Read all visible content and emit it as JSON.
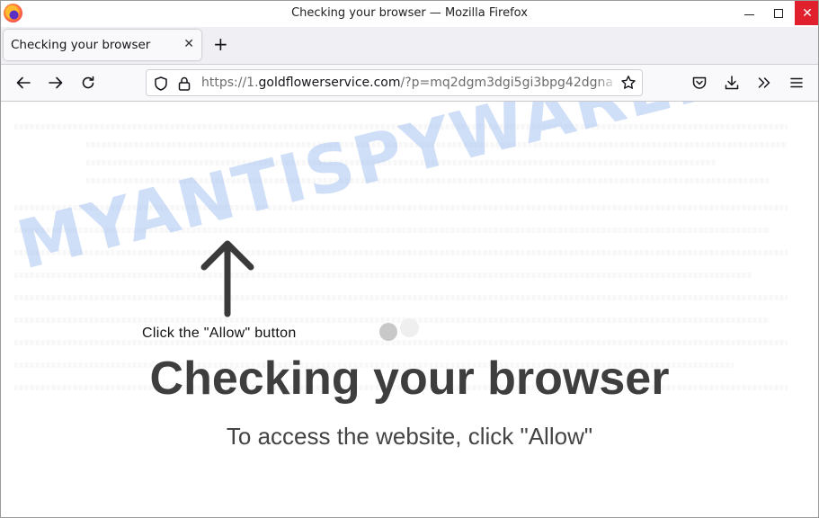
{
  "window": {
    "title": "Checking your browser — Mozilla Firefox",
    "controls": {
      "minimize": "minimize",
      "maximize": "maximize",
      "close": "✕"
    }
  },
  "tabs": [
    {
      "title": "Checking your browser",
      "active": true,
      "close_label": "✕"
    }
  ],
  "tabstrip": {
    "new_tab_label": "+"
  },
  "navbar": {
    "back": "←",
    "forward": "→",
    "reload": "↻",
    "url": {
      "prefix": "https://1.",
      "host": "goldflowerservice.com",
      "path": "/?p=mq2dgm3dgi5gi3bpg42dgna"
    }
  },
  "toolbar_icons": [
    "pocket-icon",
    "download-icon",
    "overflow-icon",
    "menu-icon"
  ],
  "page": {
    "hint": "Click the \"Allow\" button",
    "heading": "Checking your browser",
    "subheading": "To access the website, click \"Allow\"",
    "watermark": "MYANTISPYWARE.COM"
  },
  "colors": {
    "close_button": "#e0212d",
    "heading": "#3e3e3e",
    "watermark": "#96b9f0",
    "loader_dot_1": "#c8c8c8",
    "loader_dot_2": "#efefef"
  }
}
